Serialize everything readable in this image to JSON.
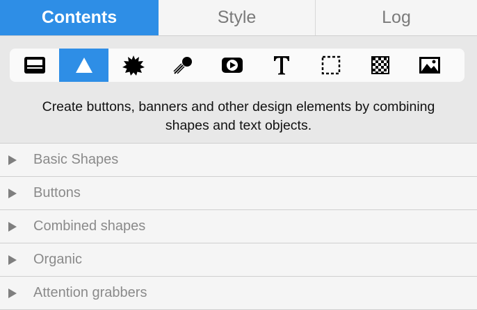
{
  "tabs": [
    {
      "label": "Contents",
      "active": true
    },
    {
      "label": "Style",
      "active": false
    },
    {
      "label": "Log",
      "active": false
    }
  ],
  "toolbar": {
    "tools": [
      {
        "icon": "banner-icon",
        "selected": false
      },
      {
        "icon": "shape-triangle-icon",
        "selected": true
      },
      {
        "icon": "starburst-icon",
        "selected": false
      },
      {
        "icon": "comet-icon",
        "selected": false
      },
      {
        "icon": "play-button-icon",
        "selected": false
      },
      {
        "icon": "text-icon",
        "selected": false
      },
      {
        "icon": "dashed-rectangle-icon",
        "selected": false
      },
      {
        "icon": "checkerboard-icon",
        "selected": false
      },
      {
        "icon": "image-icon",
        "selected": false
      }
    ]
  },
  "description": "Create buttons, banners and other design elements by combining shapes and text objects.",
  "sections": [
    {
      "label": "Basic Shapes"
    },
    {
      "label": "Buttons"
    },
    {
      "label": "Combined shapes"
    },
    {
      "label": "Organic"
    },
    {
      "label": "Attention grabbers"
    }
  ],
  "colors": {
    "accent": "#2e8ee6",
    "muted_text": "#8a8a8a",
    "panel_bg": "#e8e8e8"
  }
}
